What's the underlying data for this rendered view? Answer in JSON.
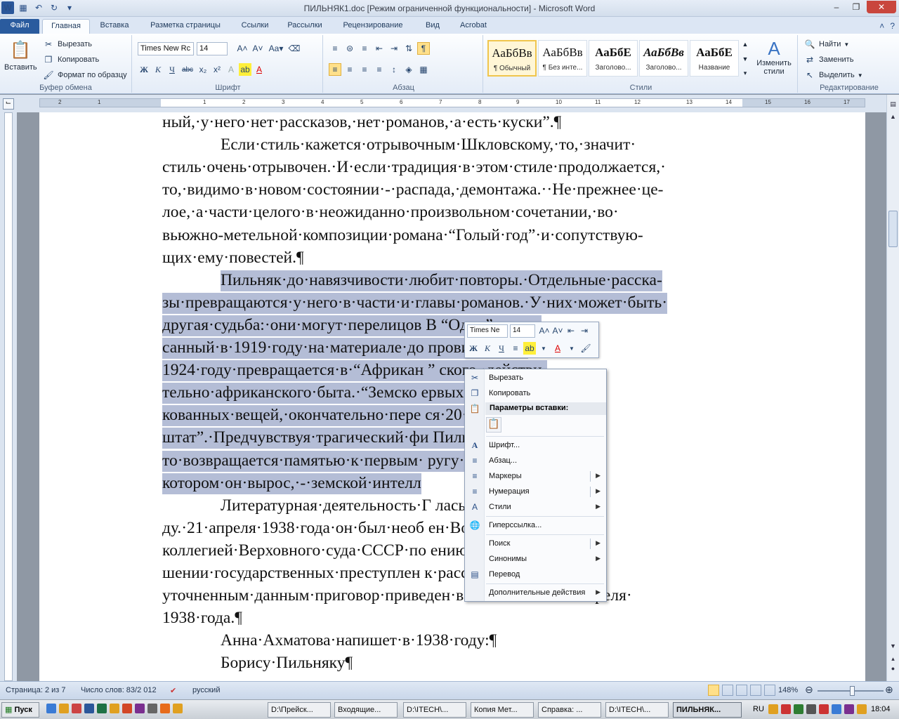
{
  "window": {
    "title": "ПИЛЬНЯК1.doc [Режим ограниченной функциональности] - Microsoft Word"
  },
  "tabs": [
    "Файл",
    "Главная",
    "Вставка",
    "Разметка страницы",
    "Ссылки",
    "Рассылки",
    "Рецензирование",
    "Вид",
    "Acrobat"
  ],
  "ribbon": {
    "clipboard": {
      "paste": "Вставить",
      "cut": "Вырезать",
      "copy": "Копировать",
      "format_painter": "Формат по образцу",
      "label": "Буфер обмена"
    },
    "font": {
      "name": "Times New Rc",
      "size": "14",
      "label": "Шрифт"
    },
    "paragraph": {
      "label": "Абзац"
    },
    "styles": {
      "label": "Стили",
      "items": [
        {
          "sample": "АаБбВв",
          "name": "¶ Обычный"
        },
        {
          "sample": "АаБбВв",
          "name": "¶ Без инте..."
        },
        {
          "sample": "АаБбЕ",
          "name": "Заголово..."
        },
        {
          "sample": "АаБбВв",
          "name": "Заголово..."
        },
        {
          "sample": "АаБбЕ",
          "name": "Название"
        }
      ],
      "change": "Изменить стили"
    },
    "editing": {
      "find": "Найти",
      "replace": "Заменить",
      "select": "Выделить",
      "label": "Редактирование"
    }
  },
  "ruler": {
    "numbers": [
      "2",
      "1",
      "1",
      "2",
      "3",
      "4",
      "5",
      "6",
      "7",
      "8",
      "9",
      "10",
      "11",
      "12",
      "13",
      "14",
      "15",
      "16",
      "17"
    ]
  },
  "document": {
    "lines": [
      {
        "text": "ный,·у·него·нет·рассказов,·нет·романов,·а·есть·куски”.¶",
        "indent": false,
        "hl": false
      },
      {
        "text": "Если·стиль·кажется·отрывочным·Шкловскому,·то,·значит·",
        "indent": true,
        "hl": false
      },
      {
        "text": "стиль·очень·отрывочен.·И·если·традиция·в·этом·стиле·продолжается,·",
        "indent": false,
        "hl": false
      },
      {
        "text": "то,·видимо·в·новом·состоянии·-·распада,·демонтажа.··Не·прежнее·це-",
        "indent": false,
        "hl": false
      },
      {
        "text": "лое,·а·части·целого·в·неожиданно·произвольном·сочетании,·во·",
        "indent": false,
        "hl": false
      },
      {
        "text": "вьюжно-метельной·композиции·романа·“Голый·год”·и·сопутствую-",
        "indent": false,
        "hl": false
      },
      {
        "text": "щих·ему·повестей.¶",
        "indent": false,
        "hl": false
      },
      {
        "text": "Пильняк·до·навязчивости·любит·повторы.·Отдельные·расска-",
        "indent": true,
        "hl": true
      },
      {
        "text": "зы·превращаются·у·него·в·части·и·главы·романов.·У·них·может·быть·",
        "indent": false,
        "hl": true
      },
      {
        "text": "другая·судьба:·они·могут·перелицов                  В        “Одно”,·напи-",
        "indent": false,
        "hl": true
      },
      {
        "text": "санный·в·1919·году·на·материале·до                         провинции,·в·",
        "indent": false,
        "hl": true
      },
      {
        "text": "1924·году·превращается·в·“Африкан       ”                  ского,·действи-",
        "indent": false,
        "hl": true
      },
      {
        "text": "тельно·африканского·быта.·“Земско                        ервых·опубли-",
        "indent": false,
        "hl": true
      },
      {
        "text": "кованных·вещей,·окончательно·пере                      ся·20·лет·в·“За-",
        "indent": false,
        "hl": true
      },
      {
        "text": "штат”.·Предчувствуя·трагический·фи                       Пильняк·как·буд-",
        "indent": false,
        "hl": true
      },
      {
        "text": "то·возвращается·памятью·к·первым·                      ругу·жизни,·в·",
        "indent": false,
        "hl": true
      },
      {
        "text": "котором·он·вырос,·-·земской·интелл",
        "indent": false,
        "hl": true
      },
      {
        "text": "Литературная·деятельность·Г                         лась·в·1937·го-",
        "indent": true,
        "hl": false
      },
      {
        "text": "ду.·21·апреля·1938·года·он·был·необ                         ен·Военной·",
        "indent": false,
        "hl": false
      },
      {
        "text": "коллегией·Верховного·суда·СССР·по                          ению·в·совер-",
        "indent": false,
        "hl": false
      },
      {
        "text": "шении·государственных·преступлен                         к·расстрелу.·По·",
        "indent": false,
        "hl": false
      },
      {
        "text": "уточненным·данным·приговор·приведен·в·исполнение·21·апреля·",
        "indent": false,
        "hl": false
      },
      {
        "text": "1938·года.¶",
        "indent": false,
        "hl": false
      },
      {
        "text": "Анна·Ахматова·напишет·в·1938·году:¶",
        "indent": true,
        "hl": false
      },
      {
        "text": "Борису·Пильняку¶",
        "indent": true,
        "hl": false
      }
    ]
  },
  "mini_toolbar": {
    "font": "Times Ne",
    "size": "14"
  },
  "context_menu": {
    "cut": "Вырезать",
    "copy": "Копировать",
    "paste_header": "Параметры вставки:",
    "font": "Шрифт...",
    "paragraph": "Абзац...",
    "bullets": "Маркеры",
    "numbering": "Нумерация",
    "styles": "Стили",
    "hyperlink": "Гиперссылка...",
    "search": "Поиск",
    "synonyms": "Синонимы",
    "translate": "Перевод",
    "more": "Дополнительные действия"
  },
  "status": {
    "page": "Страница: 2 из 7",
    "words": "Число слов: 83/2 012",
    "language": "русский",
    "zoom": "148%"
  },
  "taskbar": {
    "start": "Пуск",
    "buttons": [
      "D:\\Прейск...",
      "Входящие...",
      "D:\\ITECH\\...",
      "Копия Мет...",
      "Справка: ...",
      "D:\\ITECH\\...",
      "ПИЛЬНЯК..."
    ],
    "lang": "RU",
    "clock": "18:04"
  }
}
